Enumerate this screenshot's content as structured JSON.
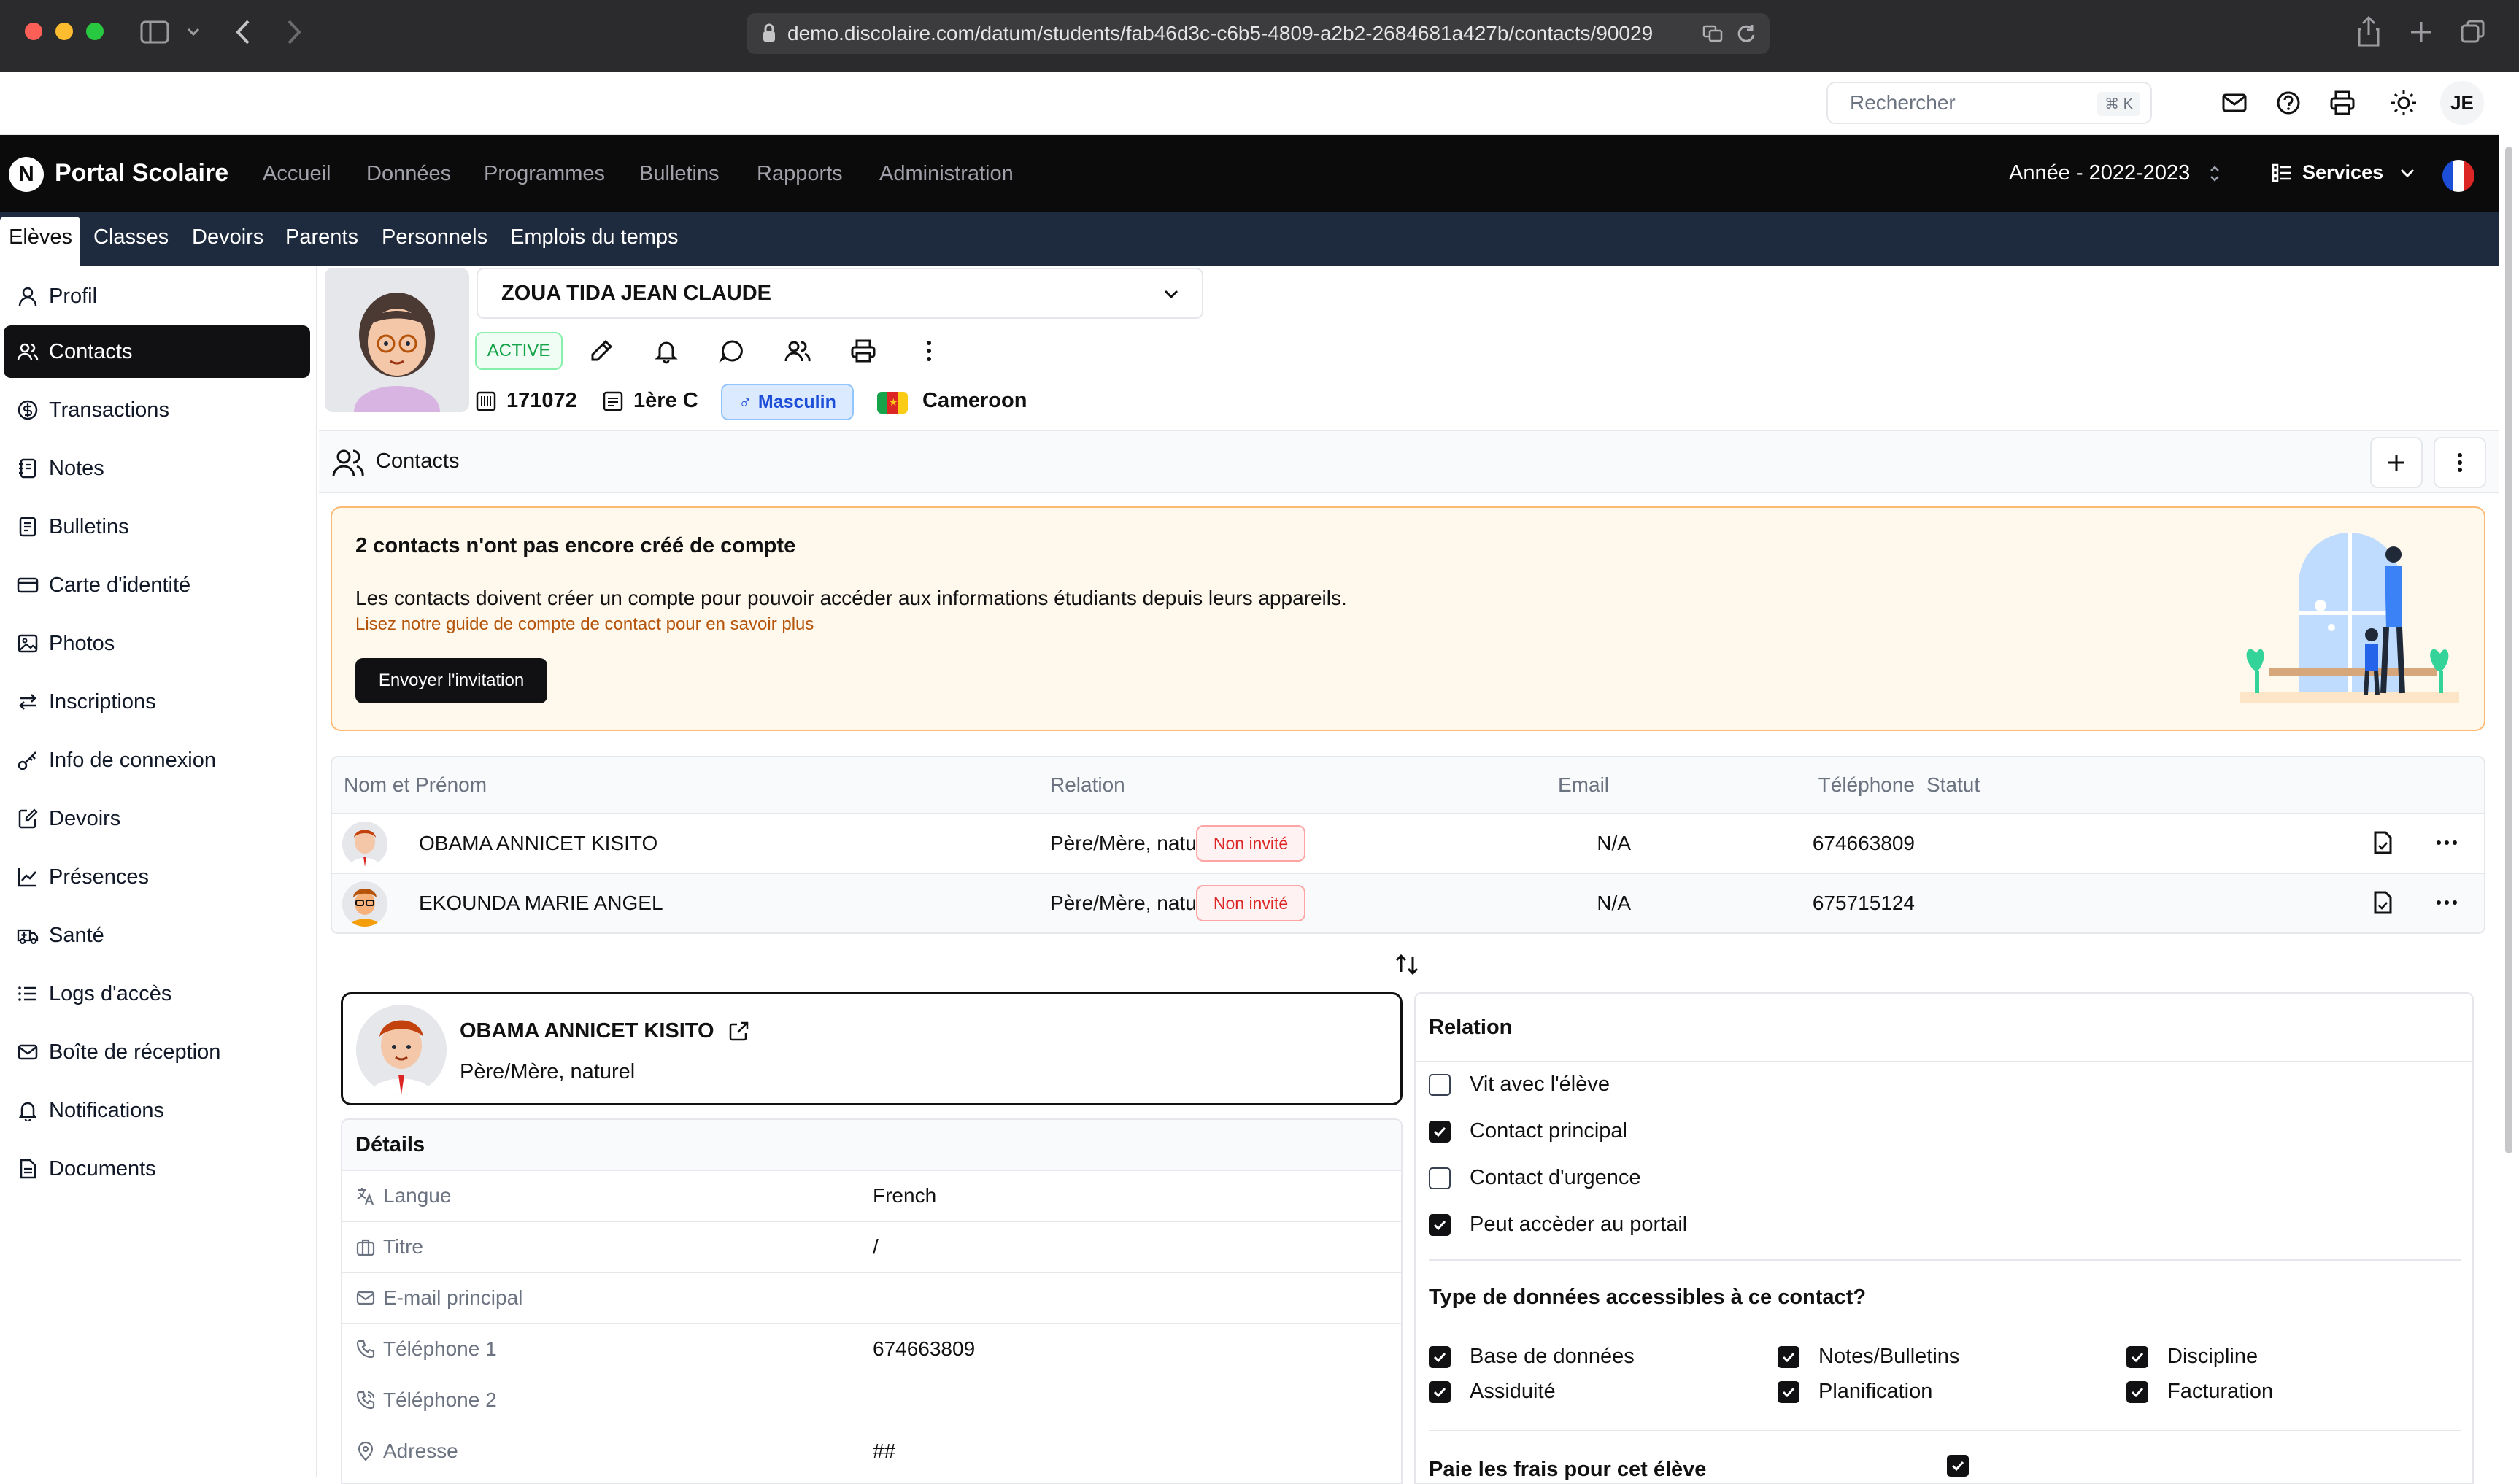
{
  "browser": {
    "url": "demo.discolaire.com/datum/students/fab46d3c-c6b5-4809-a2b2-2684681a427b/contacts/90029"
  },
  "utility": {
    "search_placeholder": "Rechercher",
    "search_shortcut": "⌘ K",
    "user_initials": "JE"
  },
  "nav": {
    "brand": "Portal Scolaire",
    "logo_letter": "N",
    "links": [
      "Accueil",
      "Données",
      "Programmes",
      "Bulletins",
      "Rapports",
      "Administration"
    ],
    "year": "Année -  2022-2023",
    "services": "Services"
  },
  "subnav": {
    "items": [
      "Elèves",
      "Classes",
      "Devoirs",
      "Parents",
      "Personnels",
      "Emplois du temps"
    ]
  },
  "sidebar": {
    "items": [
      {
        "label": "Profil",
        "icon": "user-icon"
      },
      {
        "label": "Contacts",
        "icon": "users-icon"
      },
      {
        "label": "Transactions",
        "icon": "dollar-circle-icon"
      },
      {
        "label": "Notes",
        "icon": "notebook-icon"
      },
      {
        "label": "Bulletins",
        "icon": "report-icon"
      },
      {
        "label": "Carte d'identité",
        "icon": "id-card-icon"
      },
      {
        "label": "Photos",
        "icon": "image-icon"
      },
      {
        "label": "Inscriptions",
        "icon": "swap-icon"
      },
      {
        "label": "Info de connexion",
        "icon": "key-icon"
      },
      {
        "label": "Devoirs",
        "icon": "edit-doc-icon"
      },
      {
        "label": "Présences",
        "icon": "chart-line-icon"
      },
      {
        "label": "Santé",
        "icon": "ambulance-icon"
      },
      {
        "label": "Logs d'accès",
        "icon": "list-icon"
      },
      {
        "label": "Boîte de réception",
        "icon": "mail-icon"
      },
      {
        "label": "Notifications",
        "icon": "bell-icon"
      },
      {
        "label": "Documents",
        "icon": "document-icon"
      }
    ]
  },
  "student": {
    "name": "ZOUA TIDA JEAN CLAUDE",
    "status": "ACTIVE",
    "matricule": "171072",
    "classroom": "1ère C",
    "gender": "Masculin",
    "country": "Cameroon"
  },
  "contacts": {
    "title": "Contacts",
    "banner": {
      "title": "2 contacts n'ont pas encore créé de compte",
      "description": "Les contacts doivent créer un compte pour pouvoir accéder aux informations étudiants depuis leurs appareils.",
      "guide": "Lisez notre guide de compte de contact pour en savoir plus",
      "button": "Envoyer l'invitation"
    },
    "columns": [
      "Nom et Prénom",
      "Relation",
      "Email",
      "Téléphone",
      "Statut"
    ],
    "rows": [
      {
        "name": "OBAMA ANNICET KISITO",
        "relation": "Père/Mère, naturel",
        "email": "N/A",
        "phone": "674663809",
        "status": "Non invité"
      },
      {
        "name": "EKOUNDA MARIE ANGEL",
        "relation": "Père/Mère, naturel",
        "email": "N/A",
        "phone": "675715124",
        "status": "Non invité"
      }
    ]
  },
  "selected_contact": {
    "name": "OBAMA ANNICET KISITO",
    "relation": "Père/Mère, naturel",
    "details_title": "Détails",
    "details": [
      {
        "label": "Langue",
        "value": "French",
        "icon": "language-icon"
      },
      {
        "label": "Titre",
        "value": "/",
        "icon": "briefcase-icon"
      },
      {
        "label": "E-mail principal",
        "value": "",
        "icon": "mail-icon"
      },
      {
        "label": "Téléphone 1",
        "value": "674663809",
        "icon": "phone-icon"
      },
      {
        "label": "Téléphone 2",
        "value": "",
        "icon": "phone-call-icon"
      },
      {
        "label": "Adresse",
        "value": "##",
        "icon": "map-pin-icon"
      }
    ]
  },
  "relation_panel": {
    "title": "Relation",
    "options": [
      {
        "label": "Vit avec l'élève",
        "checked": false
      },
      {
        "label": "Contact principal",
        "checked": true
      },
      {
        "label": "Contact d'urgence",
        "checked": false
      },
      {
        "label": "Peut accèder au portail",
        "checked": true
      }
    ],
    "access_title": "Type de données accessibles à ce contact?",
    "access": [
      {
        "label": "Base de données",
        "checked": true
      },
      {
        "label": "Notes/Bulletins",
        "checked": true
      },
      {
        "label": "Discipline",
        "checked": true
      },
      {
        "label": "Assiduité",
        "checked": true
      },
      {
        "label": "Planification",
        "checked": true
      },
      {
        "label": "Facturation",
        "checked": true
      }
    ],
    "fees_label": "Paie les frais pour cet élève",
    "fees_checked": true
  },
  "colors": {
    "nav_bg": "#0b0b0c",
    "subnav_bg": "#1e2a3d",
    "active_green": "#16a34a",
    "alert_red": "#dc2626",
    "banner_bg": "#fff8ed"
  }
}
